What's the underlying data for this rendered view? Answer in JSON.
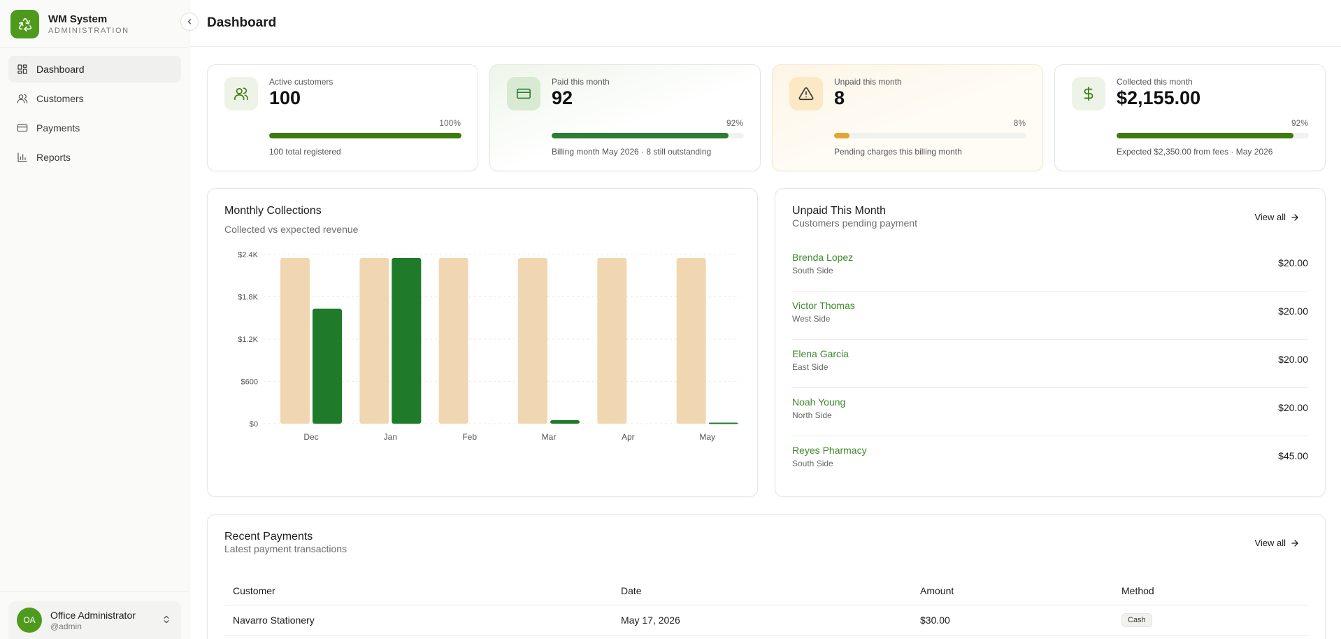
{
  "app": {
    "name": "WM System",
    "subtitle": "ADMINISTRATION"
  },
  "sidebar": {
    "items": [
      {
        "label": "Dashboard",
        "icon": "dashboard-grid-icon",
        "active": true
      },
      {
        "label": "Customers",
        "icon": "users-icon",
        "active": false
      },
      {
        "label": "Payments",
        "icon": "credit-card-icon",
        "active": false
      },
      {
        "label": "Reports",
        "icon": "bar-chart-icon",
        "active": false
      }
    ],
    "user": {
      "initials": "OA",
      "name": "Office Administrator",
      "handle": "@admin"
    }
  },
  "header": {
    "title": "Dashboard"
  },
  "stats": [
    {
      "label": "Active customers",
      "value": "100",
      "percent_text": "100%",
      "progress": 1.0,
      "footer": "100 total registered",
      "icon": "users-icon",
      "color": "#3d7a10"
    },
    {
      "label": "Paid this month",
      "value": "92",
      "percent_text": "92%",
      "progress": 0.92,
      "footer": "Billing month May 2026 · 8 still outstanding",
      "icon": "credit-card-icon",
      "color": "#2e7d32"
    },
    {
      "label": "Unpaid this month",
      "value": "8",
      "percent_text": "8%",
      "progress": 0.08,
      "footer": "Pending charges this billing month",
      "icon": "warning-triangle-icon",
      "color": "#e0a82e"
    },
    {
      "label": "Collected this month",
      "value": "$2,155.00",
      "percent_text": "92%",
      "progress": 0.92,
      "footer": "Expected $2,350.00 from fees · May 2026",
      "icon": "dollar-icon",
      "color": "#3d7a10"
    }
  ],
  "collections": {
    "title": "Monthly Collections",
    "subtitle": "Collected vs expected revenue"
  },
  "chart_data": {
    "type": "bar",
    "categories": [
      "Dec",
      "Jan",
      "Feb",
      "Mar",
      "Apr",
      "May"
    ],
    "series": [
      {
        "name": "",
        "values": [
          2350,
          2350,
          2350,
          2350,
          2350,
          2350
        ],
        "color": "#f0d7b1"
      },
      {
        "name": "",
        "values": [
          1630,
          2350,
          0,
          50,
          0,
          15
        ],
        "color": "#1f7a2a"
      }
    ],
    "ylim": [
      0,
      2400
    ],
    "yticks": [
      0,
      600,
      1200,
      1800,
      2400
    ],
    "ytick_labels": [
      "$0",
      "$600",
      "$1.2K",
      "$1.8K",
      "$2.4K"
    ],
    "grid": true
  },
  "unpaid": {
    "title": "Unpaid This Month",
    "subtitle": "Customers pending payment",
    "view_all": "View all",
    "rows": [
      {
        "name": "Brenda Lopez",
        "area": "South Side",
        "amount": "$20.00"
      },
      {
        "name": "Victor Thomas",
        "area": "West Side",
        "amount": "$20.00"
      },
      {
        "name": "Elena Garcia",
        "area": "East Side",
        "amount": "$20.00"
      },
      {
        "name": "Noah Young",
        "area": "North Side",
        "amount": "$20.00"
      },
      {
        "name": "Reyes Pharmacy",
        "area": "South Side",
        "amount": "$45.00"
      }
    ]
  },
  "recent": {
    "title": "Recent Payments",
    "subtitle": "Latest payment transactions",
    "view_all": "View all",
    "columns": [
      "Customer",
      "Date",
      "Amount",
      "Method"
    ],
    "rows": [
      {
        "customer": "Navarro Stationery",
        "date": "May 17, 2026",
        "amount": "$30.00",
        "method": "Cash"
      }
    ]
  }
}
